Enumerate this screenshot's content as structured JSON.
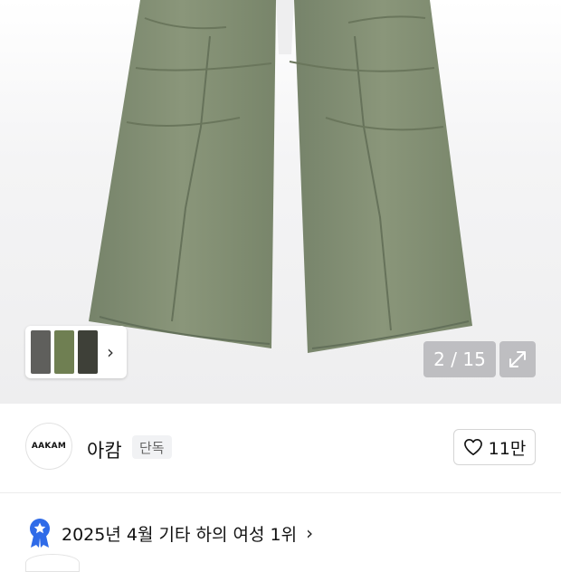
{
  "gallery": {
    "counter": "2 / 15",
    "thumb_colors": [
      "#5f5f5c",
      "#6f7f52",
      "#3e4038"
    ],
    "product_color": "#7d8a6c"
  },
  "shop": {
    "logo_text": "AAKAM",
    "name": "아캄",
    "badge": "단독",
    "likes": "11만"
  },
  "ranking": {
    "text": "2025년 4월 기타 하의 여성 1위"
  }
}
